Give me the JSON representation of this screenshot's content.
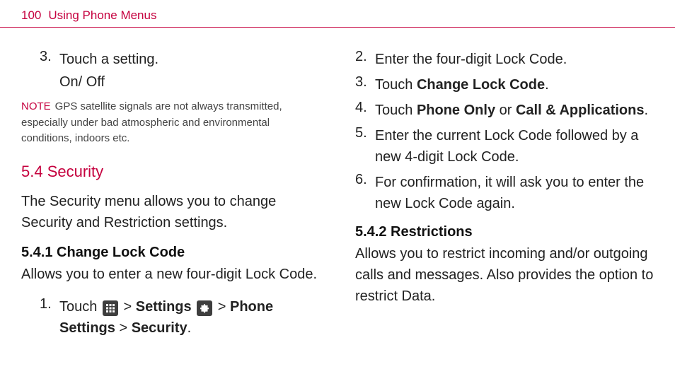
{
  "header": {
    "page_number": "100",
    "title": "Using Phone Menus"
  },
  "left": {
    "item3": {
      "num": "3.",
      "text": "Touch a setting.",
      "sub": "On/ Off"
    },
    "note": {
      "label": "NOTE",
      "text": "GPS satellite signals are not always transmitted, especially under bad atmospheric and environmental conditions, indoors etc."
    },
    "sec54": {
      "heading": "5.4 Security",
      "para": "The Security menu allows you to change Security and Restriction settings."
    },
    "sec541": {
      "heading": "5.4.1 Change Lock Code",
      "para": "Allows you to enter a new four-digit Lock Code.",
      "step1": {
        "num": "1.",
        "t1": "Touch ",
        "t2": " > ",
        "settings": "Settings",
        "t3": " ",
        "t4": " > ",
        "phone_settings": "Phone Settings",
        "t5": " > ",
        "security": "Security",
        "t6": "."
      }
    }
  },
  "right": {
    "step2": {
      "num": "2.",
      "text": "Enter the four-digit Lock Code."
    },
    "step3": {
      "num": "3.",
      "pre": "Touch ",
      "bold": "Change Lock Code",
      "post": "."
    },
    "step4": {
      "num": "4.",
      "pre": "Touch ",
      "b1": "Phone Only",
      "mid": " or ",
      "b2": "Call & Applications",
      "post": "."
    },
    "step5": {
      "num": "5.",
      "text": "Enter the current Lock Code followed by a new 4-digit Lock Code."
    },
    "step6": {
      "num": "6.",
      "text": "For confirmation, it will ask you to enter the new Lock Code again."
    },
    "sec542": {
      "heading": "5.4.2 Restrictions",
      "para": "Allows you to restrict incoming and/or outgoing calls and messages. Also provides the option to restrict Data."
    }
  }
}
